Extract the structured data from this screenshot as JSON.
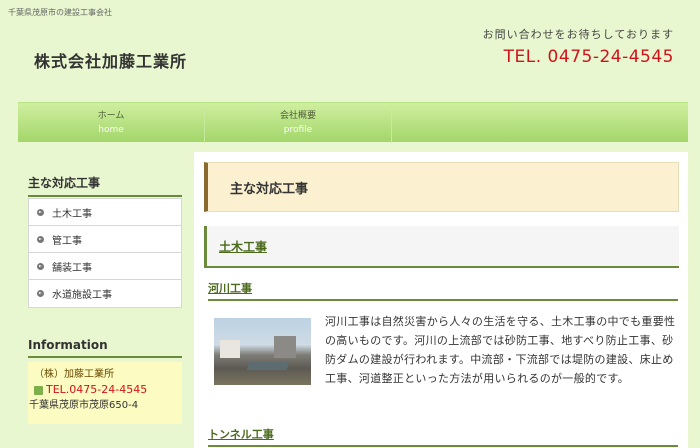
{
  "header": {
    "tagline": "千葉県茂原市の建設工事会社",
    "site_title": "株式会社加藤工業所",
    "contact_message": "お問い合わせをお待ちしております",
    "contact_tel": "TEL. 0475-24-4545"
  },
  "gnav": [
    {
      "label": "ホーム",
      "sub": "home"
    },
    {
      "label": "会社概要",
      "sub": "profile"
    }
  ],
  "sidebar": {
    "section_title": "主な対応工事",
    "items": [
      "土木工事",
      "管工事",
      "舗装工事",
      "水道施設工事"
    ],
    "info_title": "Information",
    "company": "（株）加藤工業所",
    "tel": "TEL.0475-24-4545",
    "address": "千葉県茂原市茂原650-4"
  },
  "main": {
    "page_heading": "主な対応工事",
    "section_heading": "土木工事",
    "subsection1": "河川工事",
    "subsection1_text": "河川工事は自然災害から人々の生活を守る、土木工事の中でも重要性の高いものです。河川の上流部では砂防工事、地すべり防止工事、砂防ダムの建設が行われます。中流部・下流部では堤防の建設、床止め工事、河道整正といった方法が用いられるのが一般的です。",
    "subsection2": "トンネル工事"
  },
  "colors": {
    "background": "#e8f7cf",
    "accent_green": "#6b8a3c",
    "tel_red": "#d2121a"
  }
}
